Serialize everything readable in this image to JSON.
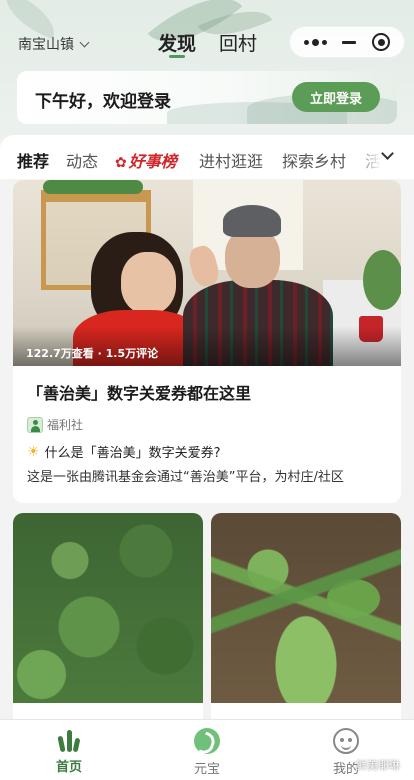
{
  "header": {
    "location": "南宝山镇",
    "tabs": [
      "发现",
      "回村"
    ],
    "active_tab": "发现"
  },
  "capsule": {
    "more_icon": "dots-icon",
    "minimize_icon": "minus-icon",
    "close_icon": "target-icon"
  },
  "login_banner": {
    "greeting": "下午好，欢迎登录",
    "button": "立即登录"
  },
  "categories": {
    "items": [
      "推荐",
      "动态",
      "好事榜",
      "进村逛逛",
      "探索乡村",
      "活"
    ],
    "active": "推荐",
    "highlight": "好事榜",
    "expand_icon": "chevron-down-icon"
  },
  "feature": {
    "stats": "122.7万查看 · 1.5万评论",
    "title": "「善治美」数字关爱券都在这里",
    "author": "福利社",
    "question": "什么是「善治美」数字关爱券?",
    "description": "这是一张由腾讯基金会通过“善治美”平台，为村庄/社区"
  },
  "tabbar": {
    "items": [
      "首页",
      "元宝",
      "我的"
    ],
    "active": "首页"
  },
  "watermark": "鲜美耶琳",
  "colors": {
    "accent": "#5b9c56",
    "active_tab": "#3e7b40",
    "highlight_red": "#d1262a"
  }
}
